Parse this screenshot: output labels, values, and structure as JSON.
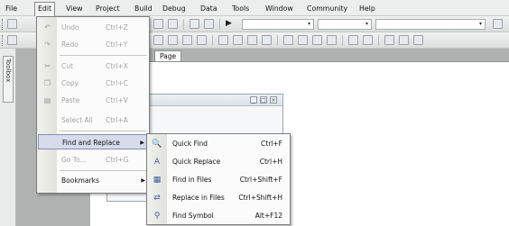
{
  "menubar": {
    "items": [
      "File",
      "Edit",
      "View",
      "Project",
      "Build",
      "Debug",
      "Data",
      "Tools",
      "Window",
      "Community",
      "Help"
    ],
    "active_index": 1
  },
  "toolbox": {
    "label": "Toolbox"
  },
  "document": {
    "tab_label": "Page"
  },
  "edit_menu": {
    "items": [
      {
        "label": "Undo",
        "shortcut": "Ctrl+Z",
        "icon": "undo-icon",
        "enabled": false
      },
      {
        "label": "Redo",
        "shortcut": "Ctrl+Y",
        "icon": "redo-icon",
        "enabled": false
      },
      {
        "label": "Cut",
        "shortcut": "Ctrl+X",
        "icon": "cut-icon",
        "enabled": false
      },
      {
        "label": "Copy",
        "shortcut": "Ctrl+C",
        "icon": "copy-icon",
        "enabled": false
      },
      {
        "label": "Paste",
        "shortcut": "Ctrl+V",
        "icon": "paste-icon",
        "enabled": false
      },
      {
        "label": "Select All",
        "shortcut": "Ctrl+A",
        "icon": "",
        "enabled": false
      },
      {
        "label": "Find and Replace",
        "shortcut": "",
        "icon": "",
        "enabled": true,
        "submenu": true,
        "highlighted": true
      },
      {
        "label": "Go To...",
        "shortcut": "Ctrl+G",
        "icon": "",
        "enabled": false
      },
      {
        "label": "Bookmarks",
        "shortcut": "",
        "icon": "",
        "enabled": true,
        "submenu": true
      }
    ]
  },
  "find_submenu": {
    "items": [
      {
        "label": "Quick Find",
        "shortcut": "Ctrl+F",
        "icon": "quick-find-icon"
      },
      {
        "label": "Quick Replace",
        "shortcut": "Ctrl+H",
        "icon": "quick-replace-icon"
      },
      {
        "label": "Find in Files",
        "shortcut": "Ctrl+Shift+F",
        "icon": "find-in-files-icon"
      },
      {
        "label": "Replace in Files",
        "shortcut": "Ctrl+Shift+H",
        "icon": "replace-in-files-icon"
      },
      {
        "label": "Find Symbol",
        "shortcut": "Alt+F12",
        "icon": "find-symbol-icon"
      }
    ]
  },
  "colors": {
    "menu_highlight": "#d7dcea",
    "menu_highlight_border": "#7f8fb5",
    "disabled_text": "#a3a3a3"
  }
}
